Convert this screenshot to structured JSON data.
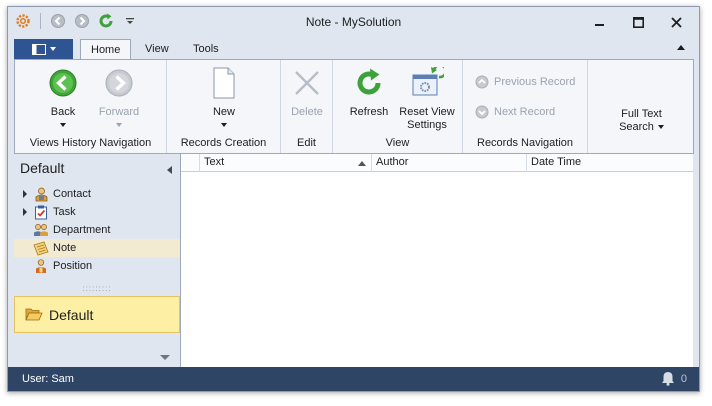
{
  "window": {
    "title": "Note - MySolution"
  },
  "ribbon": {
    "tabs": [
      {
        "label": "Home",
        "active": true
      },
      {
        "label": "View",
        "active": false
      },
      {
        "label": "Tools",
        "active": false
      }
    ],
    "groups": {
      "views_history": {
        "label": "Views History Navigation",
        "back_label": "Back",
        "forward_label": "Forward"
      },
      "records_creation": {
        "label": "Records Creation",
        "new_label": "New"
      },
      "edit": {
        "label": "Edit",
        "delete_label": "Delete"
      },
      "view": {
        "label": "View",
        "refresh_label": "Refresh",
        "reset_line1": "Reset View",
        "reset_line2": "Settings"
      },
      "records_navigation": {
        "label": "Records Navigation",
        "previous_label": "Previous Record",
        "next_label": "Next Record"
      },
      "search": {
        "line1": "Full Text",
        "line2": "Search"
      }
    }
  },
  "navigation": {
    "header": "Default",
    "items": [
      {
        "label": "Contact",
        "icon": "contact-icon",
        "expandable": true,
        "selected": false
      },
      {
        "label": "Task",
        "icon": "task-icon",
        "expandable": true,
        "selected": false
      },
      {
        "label": "Department",
        "icon": "department-icon",
        "expandable": false,
        "selected": false
      },
      {
        "label": "Note",
        "icon": "note-icon",
        "expandable": false,
        "selected": true
      },
      {
        "label": "Position",
        "icon": "position-icon",
        "expandable": false,
        "selected": false
      }
    ],
    "group_label": "Default"
  },
  "grid": {
    "columns": [
      "Text",
      "Author",
      "Date Time"
    ],
    "rows": []
  },
  "status": {
    "user": "User: Sam",
    "notifications": "0"
  },
  "colors": {
    "accent": "#2f5492",
    "statusbar": "#2e4565",
    "selection": "#f2ebd2",
    "group_highlight": "#fdf0a5"
  }
}
